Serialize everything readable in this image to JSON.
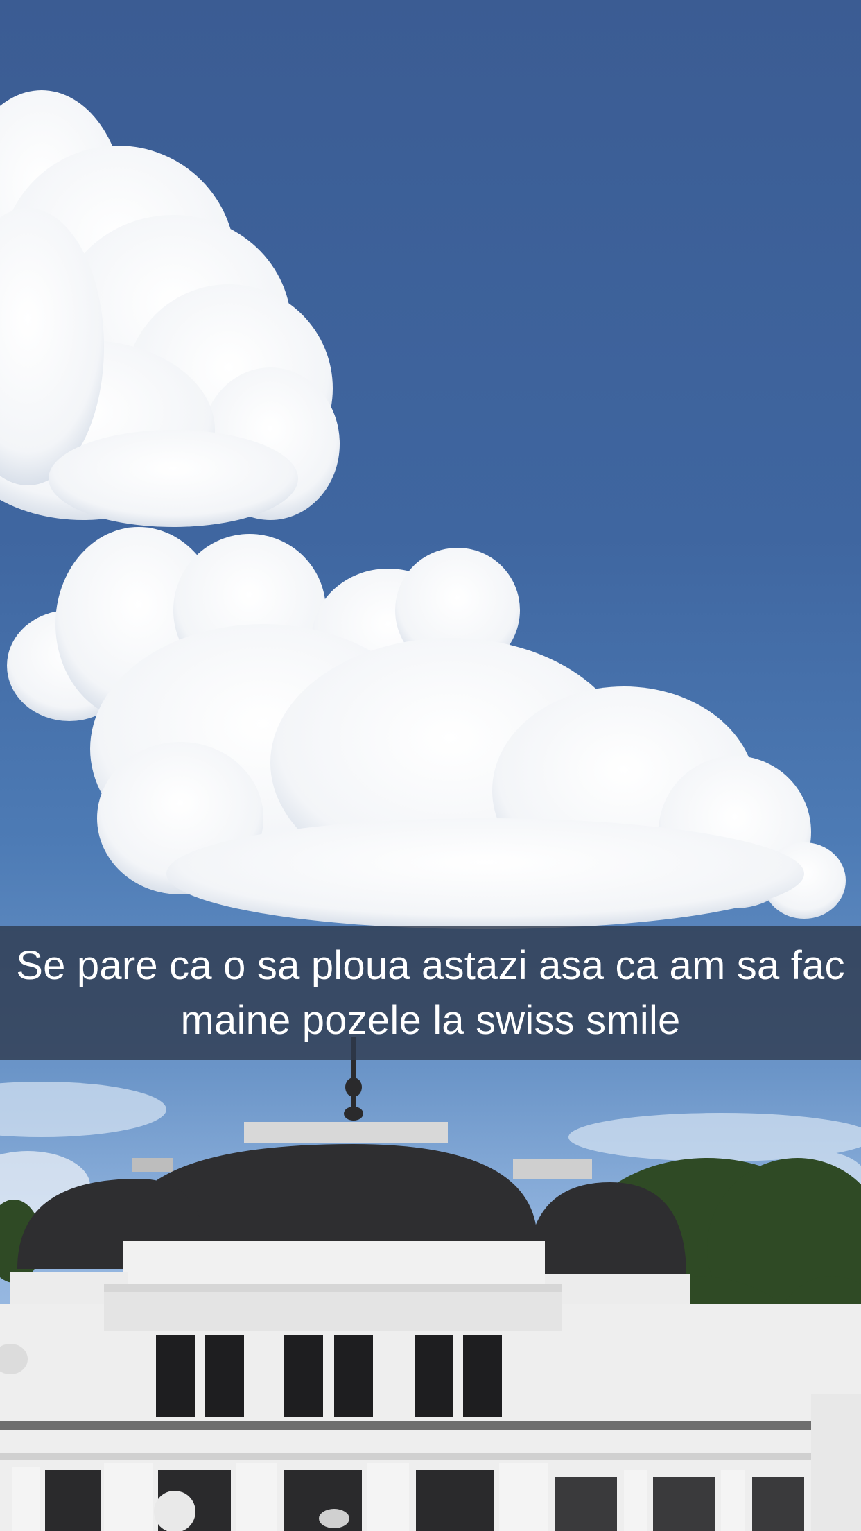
{
  "snap": {
    "caption": "Se pare ca o sa ploua astazi asa ca am sa fac maine pozele la swiss smile"
  },
  "photo": {
    "subject": "sky-with-clouds-and-white-building",
    "colors": {
      "sky_top": "#3b5c93",
      "sky_bottom": "#a9c6e8",
      "cloud": "#ffffff",
      "roof": "#2e2e30",
      "facade": "#eeeeee",
      "trees": "#2f4a25"
    }
  }
}
